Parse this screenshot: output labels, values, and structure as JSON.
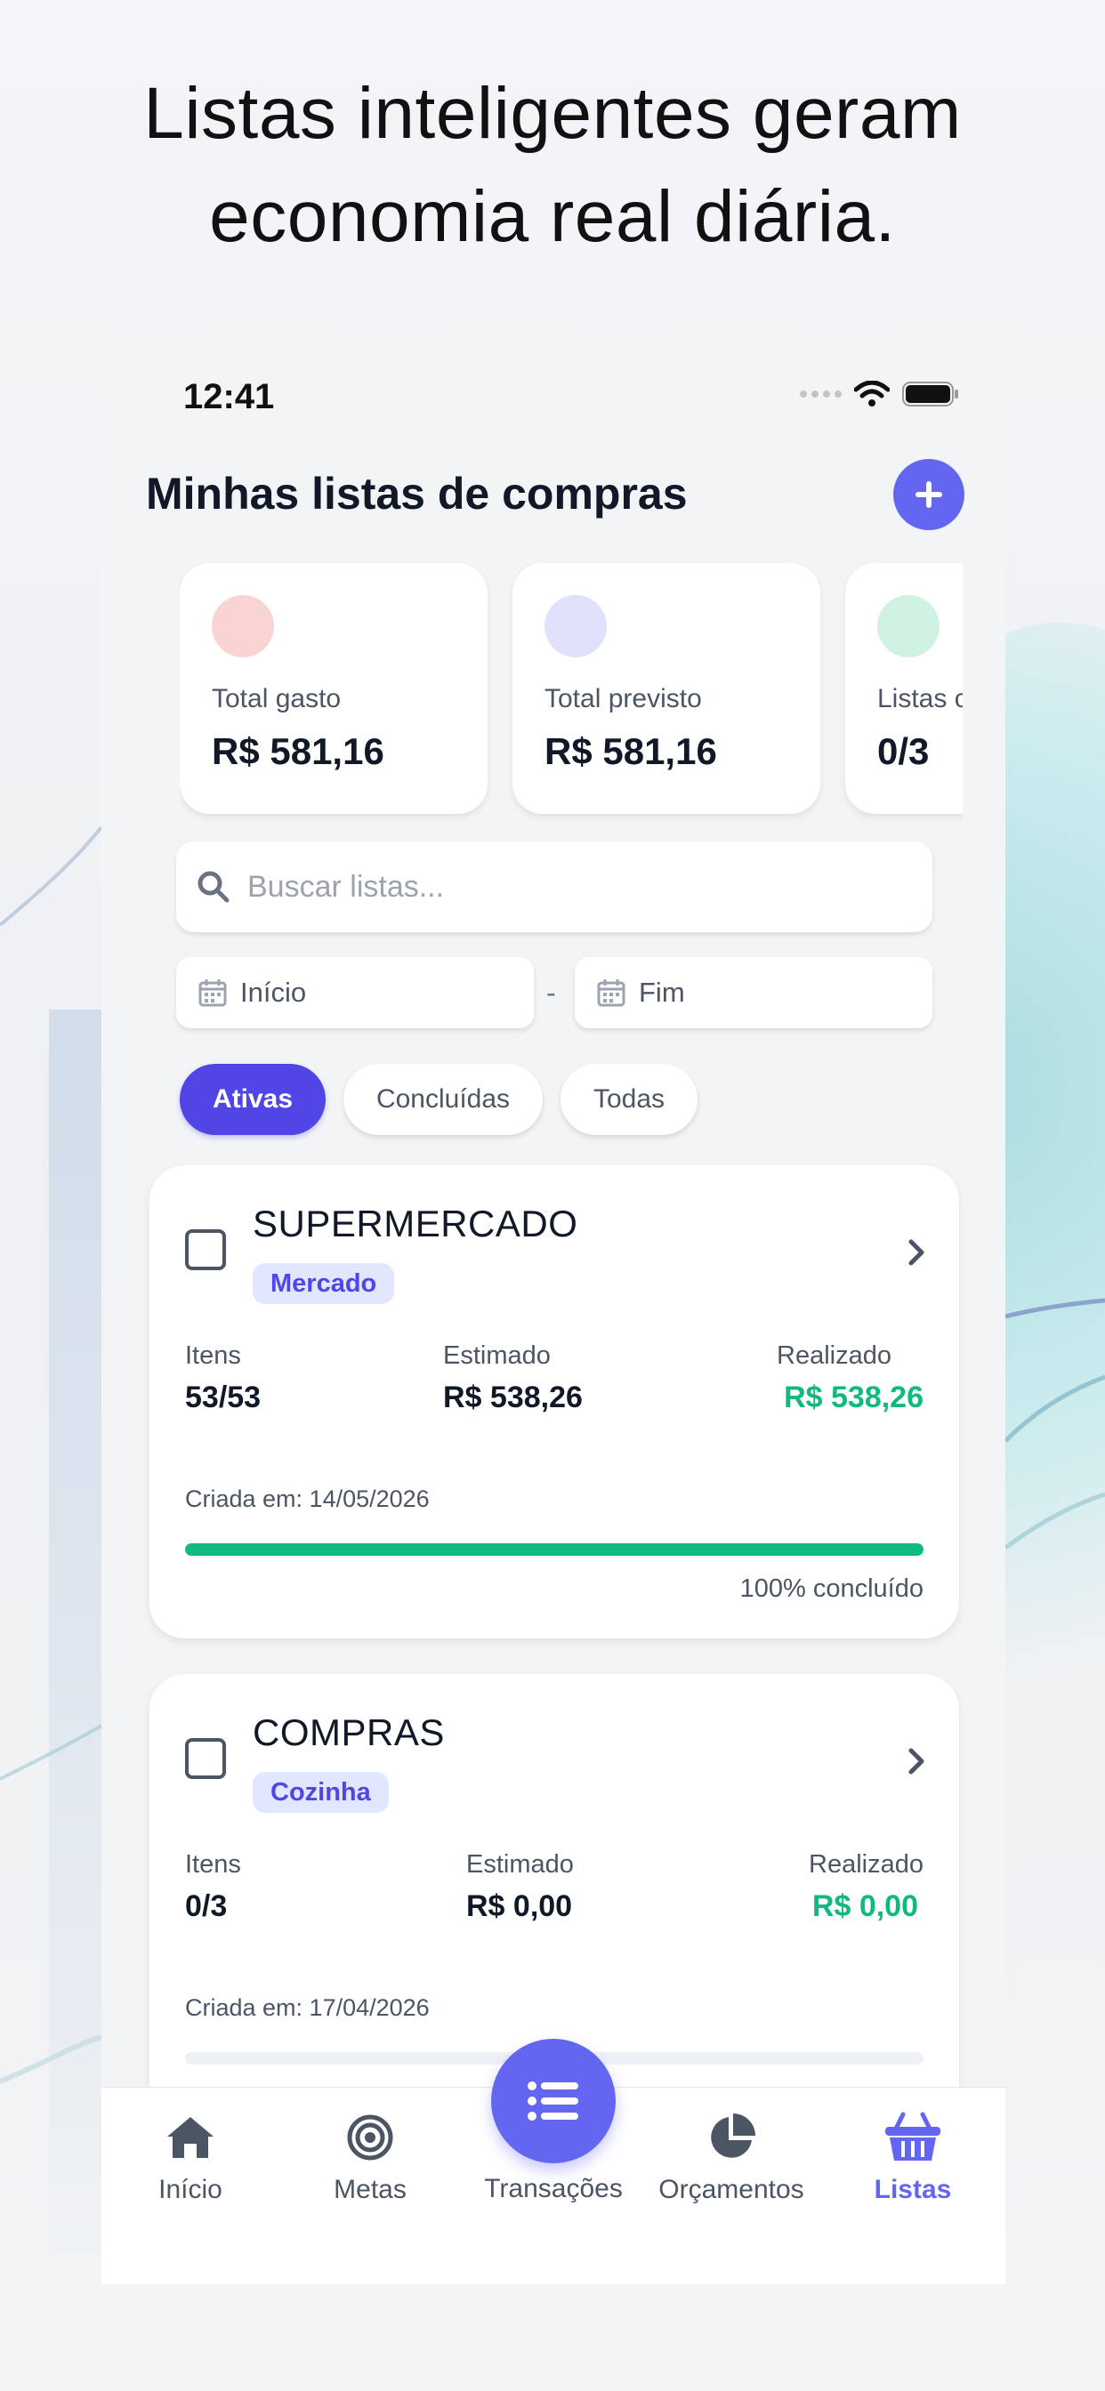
{
  "headline": {
    "line1": "Listas inteligentes geram",
    "line2": "economia real diária."
  },
  "status_bar": {
    "time": "12:41"
  },
  "header": {
    "title": "Minhas listas de compras"
  },
  "stats": [
    {
      "label": "Total gasto",
      "value": "R$ 581,16",
      "dot_color": "#fad4d4"
    },
    {
      "label": "Total previsto",
      "value": "R$ 581,16",
      "dot_color": "#e0e1fb"
    },
    {
      "label": "Listas c",
      "value": "0/3",
      "dot_color": "#d1f1e3"
    }
  ],
  "search": {
    "placeholder": "Buscar listas..."
  },
  "date_filter": {
    "start": "Início",
    "separator": "-",
    "end": "Fim"
  },
  "filters": {
    "active": "Ativas",
    "completed": "Concluídas",
    "all": "Todas"
  },
  "labels": {
    "items": "Itens",
    "estimated": "Estimado",
    "realized": "Realizado"
  },
  "lists": [
    {
      "title": "SUPERMERCADO",
      "tag": "Mercado",
      "items": "53/53",
      "estimated": "R$ 538,26",
      "realized": "R$ 538,26",
      "created": "Criada em: 14/05/2026",
      "progress": 1.0,
      "progress_text": "100% concluído"
    },
    {
      "title": "COMPRAS",
      "tag": "Cozinha",
      "items": "0/3",
      "estimated": "R$ 0,00",
      "realized": "R$ 0,00",
      "created": "Criada em: 17/04/2026",
      "progress": 0.0
    }
  ],
  "tabbar": {
    "home": "Início",
    "goals": "Metas",
    "transactions": "Transações",
    "budgets": "Orçamentos",
    "lists": "Listas"
  },
  "colors": {
    "accent": "#6366f1",
    "chip_active": "#4f46e5",
    "success": "#10b981"
  }
}
